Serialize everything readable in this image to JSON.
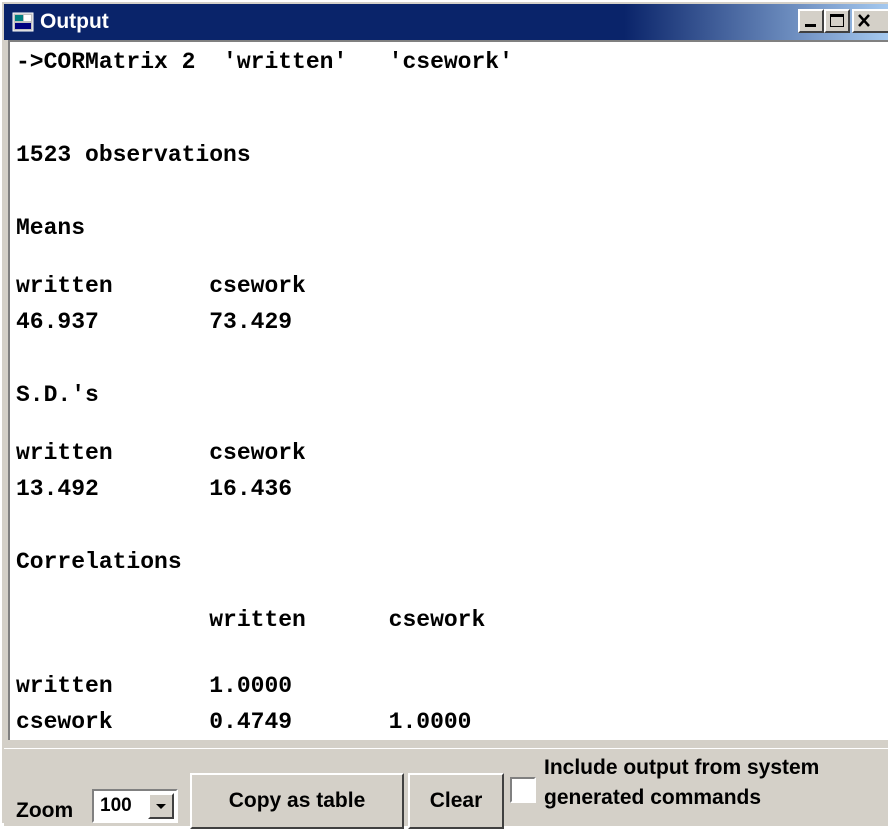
{
  "window": {
    "title": "Output",
    "controls": {
      "minimize_icon": "minimize-icon",
      "maximize_icon": "maximize-icon",
      "close_icon": "close-icon"
    }
  },
  "output": {
    "lines": [
      "->CORMatrix 2  'written'   'csework'",
      "1523 observations",
      "Means",
      "written       csework",
      "46.937        73.429",
      "S.D.'s",
      "written       csework",
      "13.492        16.436",
      "Correlations",
      "              written      csework",
      "written       1.0000",
      "csework       0.4749       1.0000"
    ]
  },
  "statusbar": {
    "zoom_label": "Zoom",
    "zoom_value": "100",
    "copy_button": "Copy as table",
    "clear_button": "Clear",
    "include_label": "Include output from system\ngenerated commands",
    "include_checked": false
  },
  "colors": {
    "titlebar": "#0a246a",
    "face": "#d4d0c8"
  }
}
